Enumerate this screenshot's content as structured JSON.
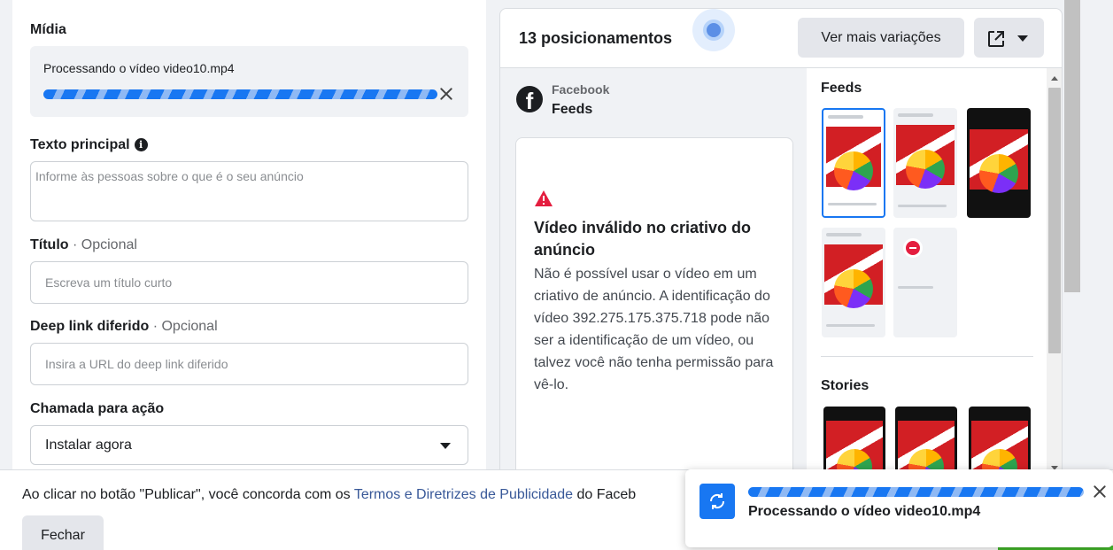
{
  "media": {
    "label": "Mídia",
    "processing_text": "Processando o vídeo video10.mp4"
  },
  "primary_text": {
    "label": "Texto principal",
    "info_glyph": "i",
    "placeholder": "Informe às pessoas sobre o que é o seu anúncio"
  },
  "headline": {
    "label": "Título",
    "optional": "· Opcional",
    "placeholder": "Escreva um título curto"
  },
  "deep_link": {
    "label": "Deep link diferido",
    "optional": "· Opcional",
    "placeholder": "Insira a URL do deep link diferido"
  },
  "cta": {
    "label": "Chamada para ação",
    "value": "Instalar agora"
  },
  "preview": {
    "title": "13 posicionamentos",
    "variations_button": "Ver mais variações",
    "platform": "Facebook",
    "placement": "Feeds",
    "logo_glyph": "f",
    "error_title": "Vídeo inválido no criativo do anúncio",
    "error_body": "Não é possível usar o vídeo em um criativo de anúncio. A identificação do vídeo 392.275.175.375.718 pode não ser a identificação de um vídeo, ou talvez você não tenha permissão para vê-lo.",
    "groups": {
      "feeds": "Feeds",
      "stories": "Stories"
    }
  },
  "footer": {
    "terms_prefix": "Ao clicar no botão \"Publicar\", você concorda com os ",
    "terms_link": "Termos e Diretrizes de Publicidade",
    "terms_suffix": " do Faceb",
    "close_button": "Fechar"
  },
  "toast": {
    "text": "Processando o vídeo video10.mp4"
  },
  "colors": {
    "accent": "#1877f2",
    "error": "#e41e3f",
    "link": "#385898",
    "publish": "#42b72a"
  },
  "icons": [
    "info-icon",
    "close-icon",
    "chevron-down-icon",
    "external-link-icon",
    "facebook-logo-icon",
    "warning-icon",
    "blocked-icon",
    "refresh-icon"
  ]
}
